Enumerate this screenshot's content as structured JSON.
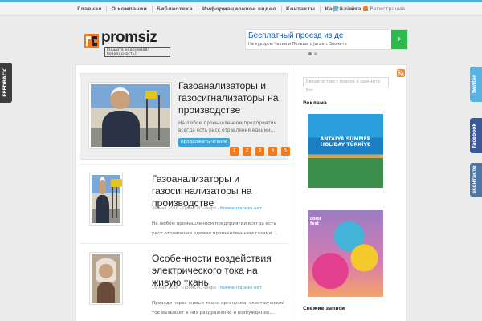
{
  "nav": {
    "items": [
      "Главная",
      "О компании",
      "Библиотека",
      "Информационное видео",
      "Контакты",
      "Карта сайта"
    ]
  },
  "auth": {
    "login": "Войти",
    "register": "Регистрация"
  },
  "logo": {
    "text": "promsiz",
    "tagline": "[защита неделимая/безопасность]"
  },
  "ad": {
    "title": "Бесплатный проезд из дс",
    "subtitle": "На курорты Чехии и Польше с Janzen. Звоните",
    "button_icon": "chevron-right-icon"
  },
  "featured": {
    "title": "Газоанализаторы и газосигнализаторы на производстве",
    "excerpt": "На любом промышленном предприятии всегда есть риск отравления едкими...",
    "read_more": "Продолжить чтение",
    "pages": [
      "1",
      "2",
      "3",
      "4",
      "5"
    ]
  },
  "posts": [
    {
      "title": "Газоанализаторы и газосигнализаторы на производстве",
      "date": "26 мая 2016",
      "author": "ПромСИЗ-Инфо",
      "comments": "Комментариев нет",
      "excerpt": "На любом промышленном предприятии всегда есть риск отравления едкими промышленными газами...."
    },
    {
      "title": "Особенности воздействия электрического тока на живую ткань",
      "date": "16 мая 2016",
      "author": "ПромСИЗ-Инфо",
      "comments": "Комментариев нет",
      "excerpt": "Проходя через живые ткани организма, электрический ток вызывает в них раздражение и возбуждение,..."
    }
  ],
  "sidebar": {
    "search_placeholder": "Введите текст поиска и нажмите Ent",
    "ads_heading": "Реклама",
    "banner1_text": "ANTALYA SUMMER HOLIDAY TÜRKİYE",
    "banner2_text": "color fest",
    "recent_heading": "Свежие записи"
  },
  "side_buttons": {
    "feedback": "FEEDBACK",
    "twitter": "Twitter",
    "facebook": "facebook",
    "vk": "вконтакте"
  },
  "colors": {
    "accent": "#3aa3d8",
    "pager": "#f07a1c",
    "top_accent": "#4fb3d9"
  }
}
